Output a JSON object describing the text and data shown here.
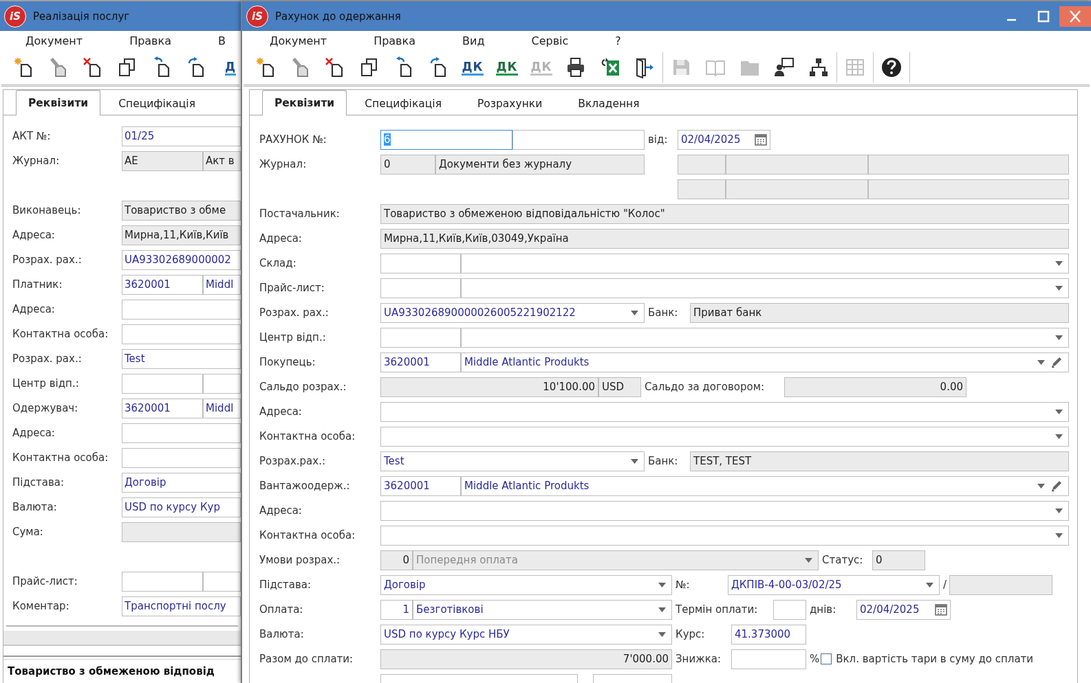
{
  "back_window": {
    "logo": "iS",
    "title": "Реалізація послуг",
    "menu": [
      "Документ",
      "Правка",
      "В"
    ],
    "toolbar": [
      {
        "kind": "new",
        "disabled": false
      },
      {
        "kind": "edit",
        "disabled": false
      },
      {
        "kind": "delete",
        "disabled": false
      },
      {
        "kind": "copy",
        "disabled": false
      },
      {
        "kind": "import",
        "disabled": false
      },
      {
        "kind": "export",
        "disabled": false
      },
      {
        "kind": "dk-split",
        "label": "Д",
        "disabled": false
      }
    ],
    "tabs": [
      {
        "label": "Реквізити",
        "selected": true
      },
      {
        "label": "Специфікація",
        "selected": false
      }
    ],
    "rows": [
      {
        "kind": "single",
        "parts": [
          {
            "kind": "label",
            "text": "АКТ №:"
          },
          {
            "kind": "field",
            "value": "01/25"
          }
        ]
      },
      {
        "kind": "pair",
        "parts": [
          {
            "kind": "label",
            "text": "Журнал:"
          },
          {
            "kind": "readonly",
            "value": "AE"
          },
          {
            "kind": "readonly",
            "value": "Акт в"
          }
        ]
      },
      {
        "kind": "blank"
      },
      {
        "kind": "single",
        "parts": [
          {
            "kind": "label",
            "text": "Виконавець:"
          },
          {
            "kind": "readonly",
            "value": "Товариство з обме"
          }
        ]
      },
      {
        "kind": "single",
        "parts": [
          {
            "kind": "label",
            "text": "Адреса:"
          },
          {
            "kind": "readonly",
            "value": "Мирна,11,Київ,Київ"
          }
        ]
      },
      {
        "kind": "single",
        "parts": [
          {
            "kind": "label",
            "text": "Розрах. рах.:"
          },
          {
            "kind": "field",
            "value": "UA93302689000002"
          }
        ]
      },
      {
        "kind": "pair",
        "parts": [
          {
            "kind": "label",
            "text": "Платник:"
          },
          {
            "kind": "field",
            "value": "3620001"
          },
          {
            "kind": "field",
            "value": "Middl"
          }
        ]
      },
      {
        "kind": "single",
        "parts": [
          {
            "kind": "label",
            "text": "Адреса:"
          },
          {
            "kind": "field"
          }
        ]
      },
      {
        "kind": "single",
        "parts": [
          {
            "kind": "label",
            "text": "Контактна особа:"
          },
          {
            "kind": "field"
          }
        ]
      },
      {
        "kind": "single",
        "parts": [
          {
            "kind": "label",
            "text": "Розрах. рах.:"
          },
          {
            "kind": "field",
            "value": "Test"
          }
        ]
      },
      {
        "kind": "pair",
        "parts": [
          {
            "kind": "label",
            "text": "Центр відп.:"
          },
          {
            "kind": "field"
          },
          {
            "kind": "field"
          }
        ]
      },
      {
        "kind": "pair",
        "parts": [
          {
            "kind": "label",
            "text": "Одержувач:"
          },
          {
            "kind": "field",
            "value": "3620001"
          },
          {
            "kind": "field",
            "value": "Middl"
          }
        ]
      },
      {
        "kind": "single",
        "parts": [
          {
            "kind": "label",
            "text": "Адреса:"
          },
          {
            "kind": "field"
          }
        ]
      },
      {
        "kind": "single",
        "parts": [
          {
            "kind": "label",
            "text": "Контактна особа:"
          },
          {
            "kind": "field"
          }
        ]
      },
      {
        "kind": "single",
        "parts": [
          {
            "kind": "label",
            "text": "Підстава:"
          },
          {
            "kind": "field",
            "value": "Договір"
          }
        ]
      },
      {
        "kind": "single",
        "parts": [
          {
            "kind": "label",
            "text": "Валюта:"
          },
          {
            "kind": "field",
            "value": "USD по курсу Кур"
          }
        ]
      },
      {
        "kind": "single",
        "parts": [
          {
            "kind": "label",
            "text": "Сума:"
          },
          {
            "kind": "readonly"
          }
        ]
      },
      {
        "kind": "blank"
      },
      {
        "kind": "pair",
        "parts": [
          {
            "kind": "label",
            "text": "Прайс-лист:"
          },
          {
            "kind": "field"
          },
          {
            "kind": "field"
          }
        ]
      },
      {
        "kind": "single",
        "parts": [
          {
            "kind": "label",
            "text": "Коментар:"
          },
          {
            "kind": "field",
            "value": "Транспортні послу"
          }
        ]
      }
    ],
    "footer_text": "Товариство з обмеженою відповід"
  },
  "front_window": {
    "logo": "iS",
    "title": "Рахунок до одержання",
    "menu": [
      "Документ",
      "Правка",
      "Вид",
      "Сервіс",
      "?"
    ],
    "toolbar": [
      {
        "kind": "new",
        "disabled": false
      },
      {
        "kind": "edit",
        "disabled": false
      },
      {
        "kind": "delete",
        "disabled": false
      },
      {
        "kind": "copy",
        "disabled": false
      },
      {
        "kind": "import",
        "disabled": false
      },
      {
        "kind": "export",
        "disabled": false
      },
      {
        "kind": "dk-split",
        "label": "ДК",
        "disabled": false
      },
      {
        "kind": "dk-up",
        "label": "ДК",
        "disabled": false
      },
      {
        "kind": "dk-down",
        "label": "ДК",
        "disabled": true
      },
      {
        "kind": "print",
        "disabled": false
      },
      {
        "kind": "excel",
        "disabled": false
      },
      {
        "kind": "exit",
        "disabled": false
      },
      {
        "kind": "separator"
      },
      {
        "kind": "save",
        "disabled": true
      },
      {
        "kind": "book",
        "disabled": true
      },
      {
        "kind": "folder",
        "disabled": true
      },
      {
        "kind": "user-chat",
        "disabled": false
      },
      {
        "kind": "hierarchy",
        "disabled": false
      },
      {
        "kind": "separator"
      },
      {
        "kind": "grid",
        "disabled": true
      },
      {
        "kind": "separator"
      },
      {
        "kind": "help",
        "disabled": false
      },
      {
        "kind": "separator"
      }
    ],
    "tabs": [
      {
        "label": "Реквізити",
        "selected": true
      },
      {
        "label": "Специфікація",
        "selected": false
      },
      {
        "label": "Розрахунки",
        "selected": false
      },
      {
        "label": "Вкладення",
        "selected": false
      }
    ],
    "rows": [
      {
        "kind": "doc",
        "parts": [
          {
            "kind": "label",
            "text": "РАХУНОК №:"
          },
          {
            "kind": "field",
            "value": "6",
            "selected": true
          },
          {
            "kind": "field"
          },
          {
            "kind": "label",
            "text": "від:"
          },
          {
            "kind": "date",
            "value": "02/04/2025"
          }
        ]
      },
      {
        "kind": "journal",
        "parts": [
          {
            "kind": "label",
            "text": "Журнал:"
          },
          {
            "kind": "readonly",
            "value": "0"
          },
          {
            "kind": "readonly",
            "value": "Документи без журналу"
          },
          {
            "kind": "readonly"
          },
          {
            "kind": "readonly"
          },
          {
            "kind": "readonly"
          }
        ]
      },
      {
        "kind": "journal-extra",
        "parts": [
          {
            "kind": "readonly"
          },
          {
            "kind": "readonly"
          },
          {
            "kind": "readonly"
          }
        ]
      },
      {
        "kind": "full",
        "parts": [
          {
            "kind": "label",
            "text": "Постачальник:"
          },
          {
            "kind": "readonly",
            "value": "Товариство з обмеженою відповідальністю \"Колос\""
          }
        ]
      },
      {
        "kind": "full",
        "parts": [
          {
            "kind": "label",
            "text": "Адреса:"
          },
          {
            "kind": "readonly",
            "value": "Мирна,11,Київ,Київ,03049,Україна"
          }
        ]
      },
      {
        "kind": "code-combo",
        "parts": [
          {
            "kind": "label",
            "text": "Склад:"
          },
          {
            "kind": "field"
          },
          {
            "kind": "combo"
          }
        ]
      },
      {
        "kind": "code-combo",
        "parts": [
          {
            "kind": "label",
            "text": "Прайс-лист:"
          },
          {
            "kind": "field"
          },
          {
            "kind": "combo"
          }
        ]
      },
      {
        "kind": "account",
        "parts": [
          {
            "kind": "label",
            "text": "Розрах. рах.:"
          },
          {
            "kind": "combo",
            "value": "UA933026890000026005221902122"
          },
          {
            "kind": "label",
            "text": "Банк:"
          },
          {
            "kind": "readonly",
            "value": "Приват банк"
          }
        ]
      },
      {
        "kind": "code-combo",
        "parts": [
          {
            "kind": "label",
            "text": "Центр відп.:"
          },
          {
            "kind": "field"
          },
          {
            "kind": "combo"
          }
        ]
      },
      {
        "kind": "code-combo",
        "parts": [
          {
            "kind": "label",
            "text": "Покупець:"
          },
          {
            "kind": "field",
            "value": "3620001"
          },
          {
            "kind": "combo-edit",
            "value": "Middle Atlantic Produkts"
          }
        ]
      },
      {
        "kind": "balance",
        "parts": [
          {
            "kind": "label",
            "text": "Сальдо розрах.:"
          },
          {
            "kind": "readonly-number",
            "value": "10'100.00"
          },
          {
            "kind": "readonly",
            "value": "USD"
          },
          {
            "kind": "label",
            "text": "Сальдо за договором:"
          },
          {
            "kind": "readonly-number",
            "value": "0.00"
          }
        ]
      },
      {
        "kind": "full",
        "parts": [
          {
            "kind": "label",
            "text": "Адреса:"
          },
          {
            "kind": "combo"
          }
        ]
      },
      {
        "kind": "full",
        "parts": [
          {
            "kind": "label",
            "text": "Контактна особа:"
          },
          {
            "kind": "combo"
          }
        ]
      },
      {
        "kind": "account",
        "parts": [
          {
            "kind": "label",
            "text": "Розрах.рах.:"
          },
          {
            "kind": "combo",
            "value": "Test"
          },
          {
            "kind": "label",
            "text": "Банк:"
          },
          {
            "kind": "readonly",
            "value": "TEST, TEST"
          }
        ]
      },
      {
        "kind": "code-combo",
        "parts": [
          {
            "kind": "label",
            "text": "Вантажоодерж.:"
          },
          {
            "kind": "field",
            "value": "3620001"
          },
          {
            "kind": "combo-edit",
            "value": "Middle Atlantic Produkts"
          }
        ]
      },
      {
        "kind": "full",
        "parts": [
          {
            "kind": "label",
            "text": "Адреса:"
          },
          {
            "kind": "combo"
          }
        ]
      },
      {
        "kind": "full",
        "parts": [
          {
            "kind": "label",
            "text": "Контактна особа:"
          },
          {
            "kind": "combo"
          }
        ]
      },
      {
        "kind": "terms",
        "parts": [
          {
            "kind": "label",
            "text": "Умови розрах.:"
          },
          {
            "kind": "readonly-number",
            "value": "0"
          },
          {
            "kind": "combo",
            "value": "Попередня оплата",
            "disabled": true
          },
          {
            "kind": "label",
            "text": "Статус:"
          },
          {
            "kind": "readonly",
            "value": "0"
          }
        ]
      },
      {
        "kind": "basis",
        "parts": [
          {
            "kind": "label",
            "text": "Підстава:"
          },
          {
            "kind": "combo",
            "value": "Договір"
          },
          {
            "kind": "label",
            "text": "№:"
          },
          {
            "kind": "combo",
            "value": "ДКПІВ-4-00-03/02/25"
          },
          {
            "kind": "label",
            "text": "/"
          },
          {
            "kind": "readonly"
          }
        ]
      },
      {
        "kind": "payment",
        "parts": [
          {
            "kind": "label",
            "text": "Оплата:"
          },
          {
            "kind": "field-number",
            "value": "1"
          },
          {
            "kind": "combo",
            "value": "Безготівкові"
          },
          {
            "kind": "label",
            "text": "Термін оплати:"
          },
          {
            "kind": "field"
          },
          {
            "kind": "label",
            "text": "днів:"
          },
          {
            "kind": "date",
            "value": "02/04/2025"
          }
        ]
      },
      {
        "kind": "currency",
        "parts": [
          {
            "kind": "label",
            "text": "Валюта:"
          },
          {
            "kind": "combo",
            "value": "USD по курсу Курс НБУ"
          },
          {
            "kind": "label",
            "text": "Курс:"
          },
          {
            "kind": "field",
            "value": "41.373000"
          }
        ]
      },
      {
        "kind": "total",
        "parts": [
          {
            "kind": "label",
            "text": "Разом до сплати:"
          },
          {
            "kind": "readonly-number",
            "value": "7'000.00"
          },
          {
            "kind": "label",
            "text": "Знижка:"
          },
          {
            "kind": "field"
          },
          {
            "kind": "label",
            "text": "%"
          },
          {
            "kind": "checkbox",
            "checked": false,
            "text": "Вкл. вартість тари в суму до сплати"
          }
        ]
      },
      {
        "kind": "partial",
        "parts": [
          {
            "kind": "field"
          },
          {
            "kind": "field"
          }
        ]
      }
    ]
  }
}
